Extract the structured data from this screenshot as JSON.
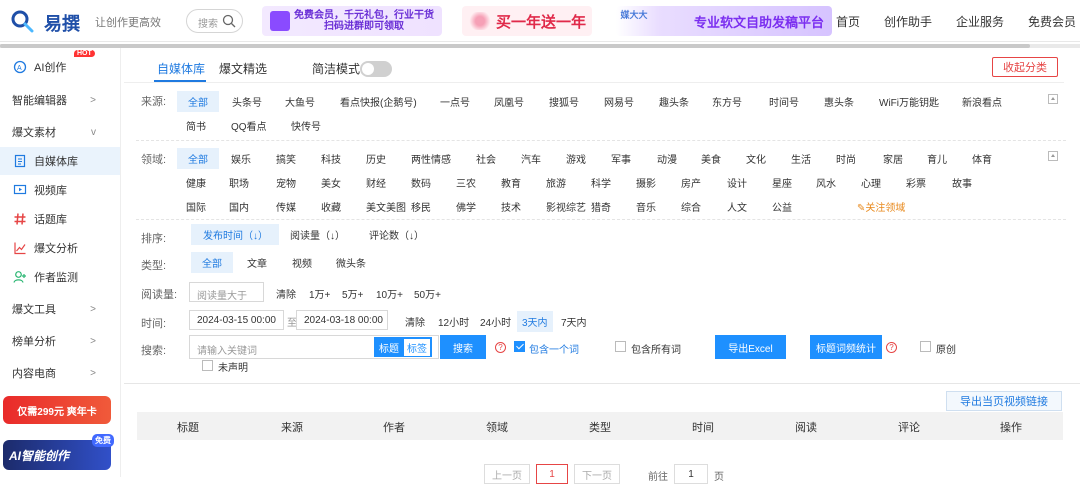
{
  "header": {
    "logo_text": "易撰",
    "slogan": "让创作更高效",
    "search_placeholder": "搜索",
    "banner1_line1": "免费会员，千元礼包，行业干货",
    "banner1_line2": "扫码进群即可领取",
    "banner2_text": "买一年送一年",
    "banner3_brand": "媒大大",
    "banner3_text": "专业软文自助发稿平台",
    "nav": [
      "首页",
      "创作助手",
      "企业服务",
      "免费会员"
    ]
  },
  "sidebar": {
    "ai_label": "AI创作",
    "hot": "HOT",
    "items": [
      {
        "label": "智能编辑器",
        "arrow": ">"
      },
      {
        "label": "爆文素材",
        "arrow": "v"
      },
      {
        "label": "自媒体库"
      },
      {
        "label": "视频库"
      },
      {
        "label": "话题库"
      },
      {
        "label": "爆文分析"
      },
      {
        "label": "作者监测"
      },
      {
        "label": "爆文工具",
        "arrow": ">"
      },
      {
        "label": "榜单分析",
        "arrow": ">"
      },
      {
        "label": "内容电商",
        "arrow": ">"
      }
    ],
    "promo1": "仅需299元 爽年卡",
    "promo2": "AI智能创作",
    "promo2_tag": "免费"
  },
  "tabs": {
    "t1": "自媒体库",
    "t2": "爆文精选",
    "simple_mode": "简洁模式",
    "collapse": "收起分类"
  },
  "filters": {
    "source_label": "来源:",
    "sources": [
      "全部",
      "头条号",
      "大鱼号",
      "看点快报(企鹅号)",
      "一点号",
      "凤凰号",
      "搜狐号",
      "网易号",
      "趣头条",
      "东方号",
      "时间号",
      "惠头条",
      "WiFi万能钥匙",
      "新浪看点",
      "简书",
      "QQ看点",
      "快传号"
    ],
    "field_label": "领域:",
    "fields": [
      "全部",
      "娱乐",
      "搞笑",
      "科技",
      "历史",
      "两性情感",
      "社会",
      "汽车",
      "游戏",
      "军事",
      "动漫",
      "美食",
      "文化",
      "生活",
      "时尚",
      "家居",
      "育儿",
      "体育",
      "健康",
      "职场",
      "宠物",
      "美女",
      "财经",
      "数码",
      "三农",
      "教育",
      "旅游",
      "科学",
      "摄影",
      "房产",
      "设计",
      "星座",
      "风水",
      "心理",
      "彩票",
      "故事",
      "国际",
      "国内",
      "传媒",
      "收藏",
      "美文美图",
      "移民",
      "佛学",
      "技术",
      "影视综艺",
      "猎奇",
      "音乐",
      "综合",
      "人文",
      "公益"
    ],
    "follow_field": "关注领域",
    "sort_label": "排序:",
    "sorts": [
      "发布时间（↓）",
      "阅读量（↓）",
      "评论数（↓）"
    ],
    "type_label": "类型:",
    "types": [
      "全部",
      "文章",
      "视频",
      "微头条"
    ],
    "read_label": "阅读量:",
    "read_placeholder": "阅读量大于",
    "read_clear": "清除",
    "read_opts": [
      "1万+",
      "5万+",
      "10万+",
      "50万+"
    ],
    "time_label": "时间:",
    "time_from": "2024-03-15 00:00",
    "time_to_sep": "至",
    "time_to": "2024-03-18 00:00",
    "time_clear": "清除",
    "time_opts": [
      "12小时",
      "24小时",
      "3天内",
      "7天内"
    ],
    "search_label": "搜索:",
    "search_placeholder": "请输入关键词",
    "seg_title": "标题",
    "seg_tag": "标签",
    "search_btn": "搜索",
    "contains_one": "包含一个词",
    "contains_all": "包含所有词",
    "export_excel": "导出Excel",
    "title_freq": "标题词频统计",
    "original": "原创",
    "undeclared": "未声明"
  },
  "table": {
    "export_video": "导出当页视频链接",
    "headers": [
      "标题",
      "来源",
      "作者",
      "领域",
      "类型",
      "时间",
      "阅读",
      "评论",
      "操作"
    ]
  },
  "pagination": {
    "prev": "上一页",
    "current": "1",
    "next": "下一页",
    "goto": "前往",
    "page_value": "1",
    "page_unit": "页"
  }
}
